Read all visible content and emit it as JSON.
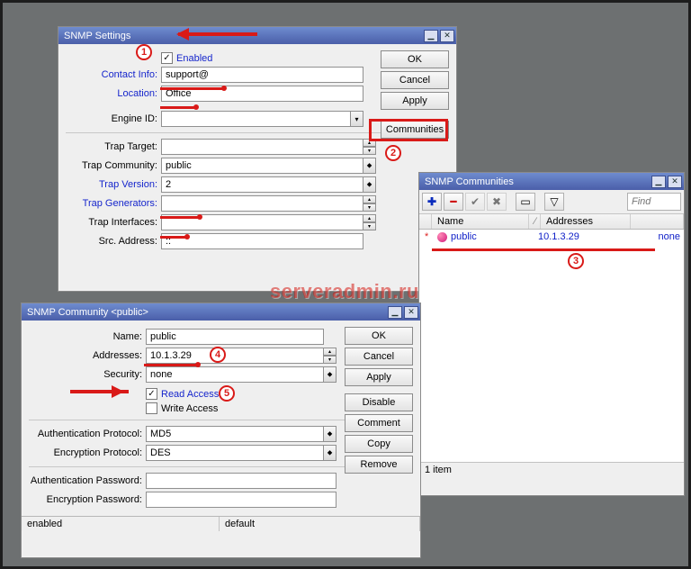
{
  "watermark": "serveradmin.ru",
  "markers": {
    "m1": "1",
    "m2": "2",
    "m3": "3",
    "m4": "4",
    "m5": "5"
  },
  "settings": {
    "title": "SNMP Settings",
    "enabled_label": "Enabled",
    "contact_label": "Contact Info:",
    "contact_value": "support@",
    "location_label": "Location:",
    "location_value": "Office",
    "engineid_label": "Engine ID:",
    "engineid_value": "",
    "trap_target_label": "Trap Target:",
    "trap_target_value": "",
    "trap_community_label": "Trap Community:",
    "trap_community_value": "public",
    "trap_version_label": "Trap Version:",
    "trap_version_value": "2",
    "trap_generators_label": "Trap Generators:",
    "trap_generators_value": "",
    "trap_interfaces_label": "Trap Interfaces:",
    "trap_interfaces_value": "",
    "src_address_label": "Src. Address:",
    "src_address_value": "::",
    "buttons": {
      "ok": "OK",
      "cancel": "Cancel",
      "apply": "Apply",
      "communities": "Communities"
    }
  },
  "communities": {
    "title": "SNMP Communities",
    "find_placeholder": "Find",
    "cols": {
      "name": "Name",
      "addresses": "Addresses"
    },
    "rows": [
      {
        "star": "*",
        "name": "public",
        "addresses": "10.1.3.29",
        "sec": "none"
      }
    ],
    "count": "1 item"
  },
  "community": {
    "title": "SNMP Community <public>",
    "name_label": "Name:",
    "name_value": "public",
    "addresses_label": "Addresses:",
    "addresses_value": "10.1.3.29",
    "security_label": "Security:",
    "security_value": "none",
    "read_access_label": "Read Access",
    "write_access_label": "Write Access",
    "auth_proto_label": "Authentication Protocol:",
    "auth_proto_value": "MD5",
    "enc_proto_label": "Encryption Protocol:",
    "enc_proto_value": "DES",
    "auth_pass_label": "Authentication Password:",
    "auth_pass_value": "",
    "enc_pass_label": "Encryption Password:",
    "enc_pass_value": "",
    "status": {
      "left": "enabled",
      "right": "default"
    },
    "buttons": {
      "ok": "OK",
      "cancel": "Cancel",
      "apply": "Apply",
      "disable": "Disable",
      "comment": "Comment",
      "copy": "Copy",
      "remove": "Remove"
    }
  }
}
